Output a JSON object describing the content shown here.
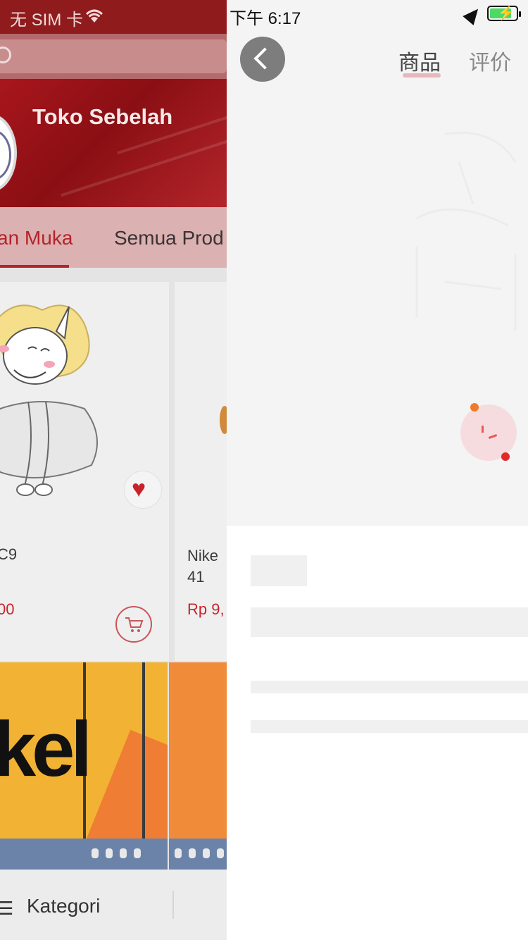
{
  "left_page": {
    "status": {
      "carrier": "无 SIM 卡"
    },
    "shop": {
      "name": "Toko Sebelah"
    },
    "tabs": [
      {
        "label": "an Muka",
        "active": true
      },
      {
        "label": "Semua Prod",
        "active": false
      }
    ],
    "products": [
      {
        "name": "C9",
        "price": "00"
      },
      {
        "name": "Nike\n41",
        "price": "Rp 9,"
      }
    ],
    "banner_text": "kel",
    "bottom_bar": {
      "category_label": "Kategori"
    },
    "colors": {
      "brand": "#b3242a",
      "price": "#c8232b"
    }
  },
  "right_page": {
    "status": {
      "time": "下午 6:17"
    },
    "tabs": [
      {
        "label": "商品",
        "active": true
      },
      {
        "label": "评价",
        "active": false
      }
    ],
    "colors": {
      "skeleton": "#f0f0f0",
      "tab_indicator": "#e8b6bd"
    }
  }
}
